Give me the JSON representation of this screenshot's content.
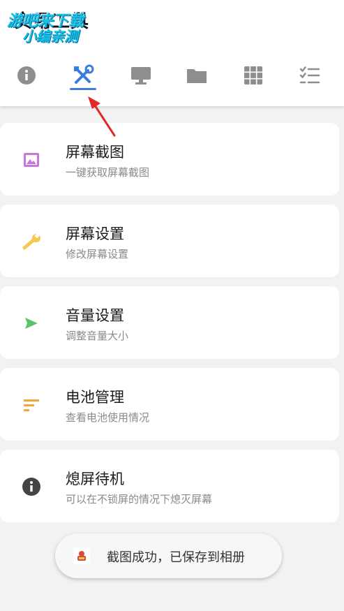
{
  "header": {
    "title": "实用工具",
    "watermark": {
      "line1": "游吧来下载",
      "line2": "小编亲测"
    }
  },
  "tabs": [
    {
      "name": "info",
      "icon": "info-icon",
      "selected": false
    },
    {
      "name": "tools",
      "icon": "tools-icon",
      "selected": true
    },
    {
      "name": "display",
      "icon": "monitor-icon",
      "selected": false
    },
    {
      "name": "files",
      "icon": "folder-icon",
      "selected": false
    },
    {
      "name": "apps",
      "icon": "grid-icon",
      "selected": false
    },
    {
      "name": "tasks",
      "icon": "checklist-icon",
      "selected": false
    }
  ],
  "colors": {
    "accent": "#3b7ddd",
    "annotation_arrow": "#e02a2a",
    "tab_icon": "#8e8e8e"
  },
  "items": [
    {
      "label": "屏幕截图",
      "desc": "一键获取屏幕截图",
      "icon": "image-icon",
      "color": "#c777dd"
    },
    {
      "label": "屏幕设置",
      "desc": "修改屏幕设置",
      "icon": "wrench-icon",
      "color": "#f6c94e"
    },
    {
      "label": "音量设置",
      "desc": "调整音量大小",
      "icon": "send-icon",
      "color": "#58c46e"
    },
    {
      "label": "电池管理",
      "desc": "查看电池使用情况",
      "icon": "sort-icon",
      "color": "#f5a43a"
    },
    {
      "label": "熄屏待机",
      "desc": "可以在不锁屏的情况下熄灭屏幕",
      "icon": "info-icon",
      "color": "#444444"
    }
  ],
  "toast": {
    "text": "截图成功，已保存到相册",
    "icon": "app-icon"
  }
}
